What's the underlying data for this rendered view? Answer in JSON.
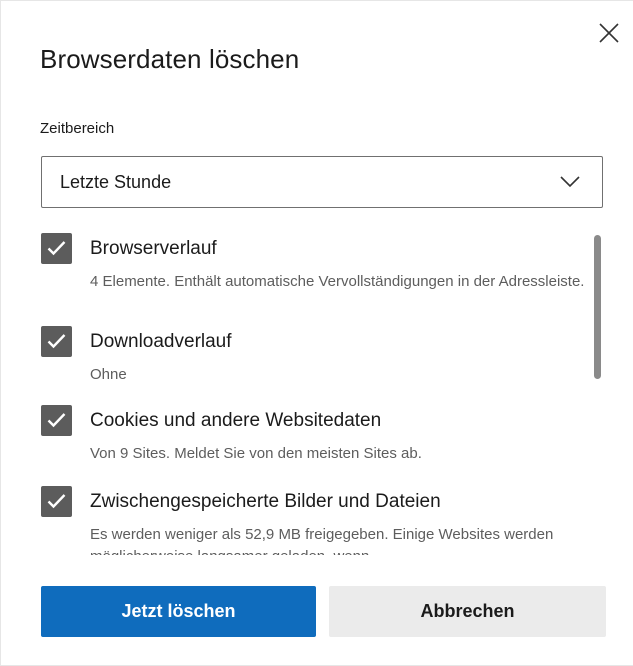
{
  "dialog": {
    "title": "Browserdaten löschen",
    "close_icon": "close-icon"
  },
  "time_range": {
    "label": "Zeitbereich",
    "selected": "Letzte Stunde",
    "chevron_icon": "chevron-down-icon"
  },
  "options": [
    {
      "title": "Browserverlauf",
      "description": "4 Elemente. Enthält automatische Vervollständigungen in der Adressleiste.",
      "checked": true
    },
    {
      "title": "Downloadverlauf",
      "description": "Ohne",
      "checked": true
    },
    {
      "title": "Cookies und andere Websitedaten",
      "description": "Von 9 Sites. Meldet Sie von den meisten Sites ab.",
      "checked": true
    },
    {
      "title": "Zwischengespeicherte Bilder und Dateien",
      "description": "Es werden weniger als 52,9 MB freigegeben. Einige Websites werden möglicherweise langsamer geladen, wenn",
      "checked": true
    }
  ],
  "buttons": {
    "clear_label": "Jetzt löschen",
    "cancel_label": "Abbrechen"
  },
  "colors": {
    "primary": "#0f6cbd",
    "checkbox": "#5c5c5c",
    "secondary_button": "#ebebeb"
  }
}
